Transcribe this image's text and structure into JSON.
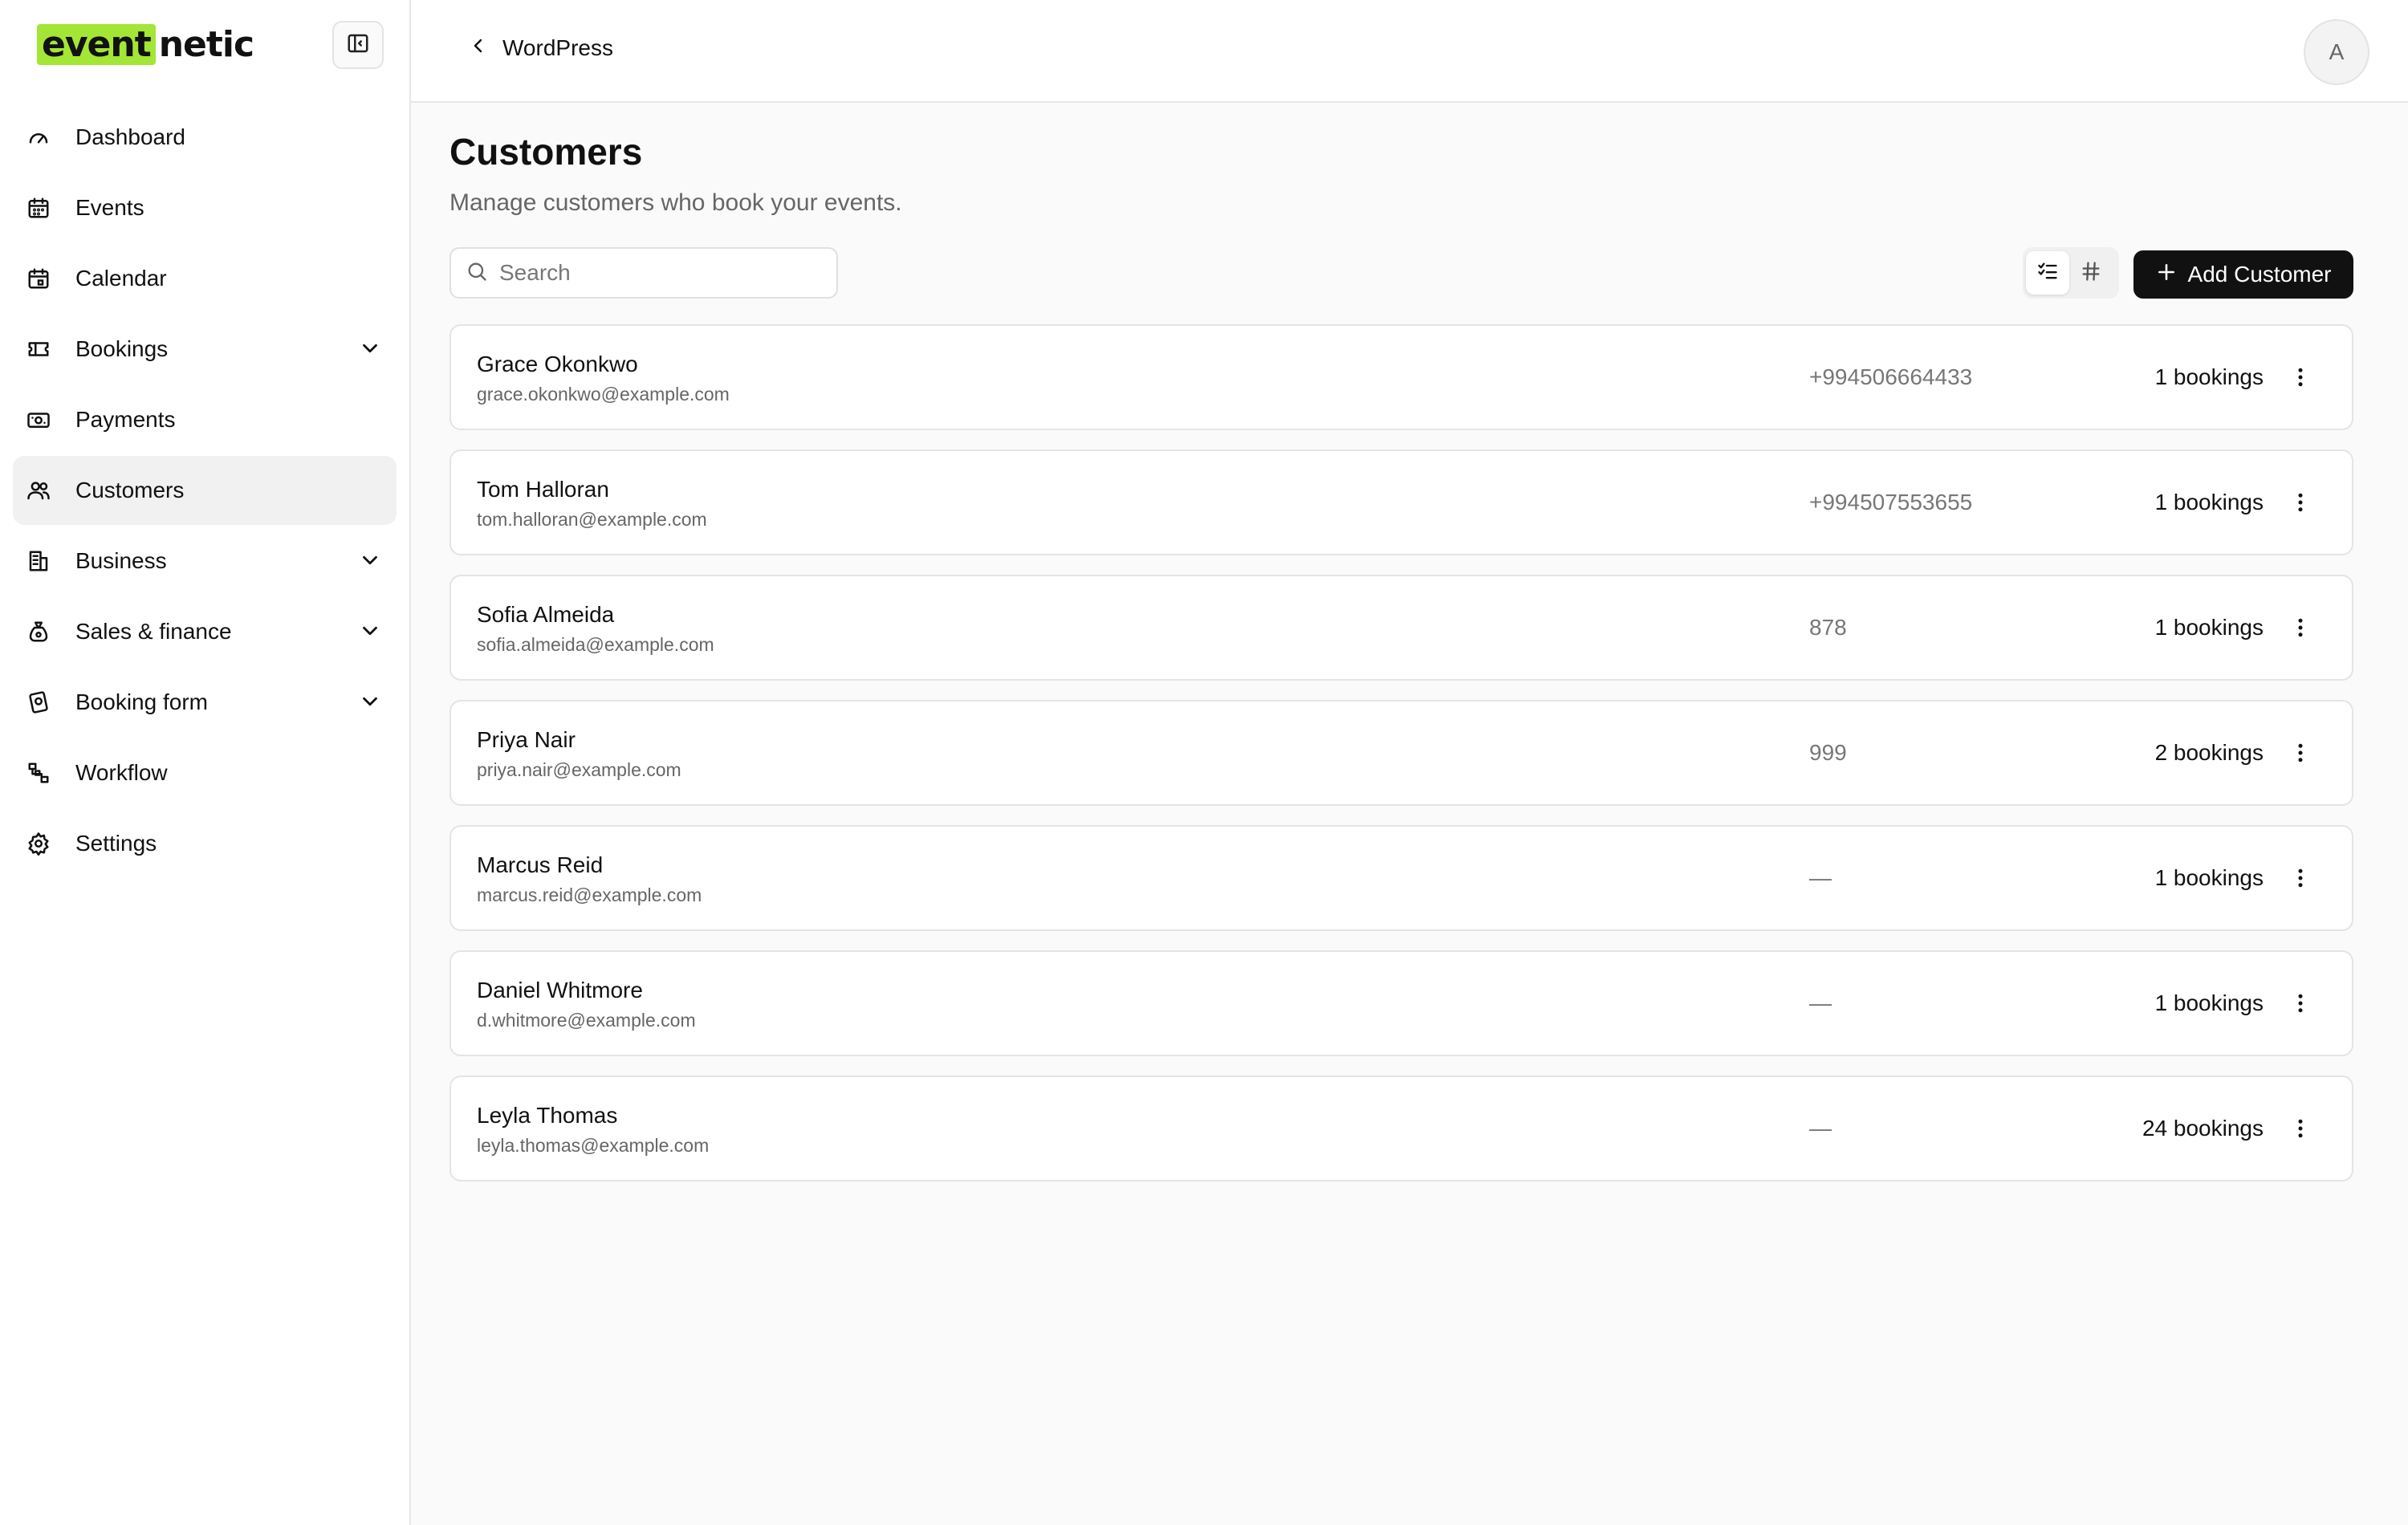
{
  "brand": {
    "highlight": "event",
    "rest": "netic",
    "accent": "#a3e635"
  },
  "sidebar": {
    "items": [
      {
        "label": "Dashboard",
        "icon": "gauge-icon",
        "expandable": false,
        "active": false
      },
      {
        "label": "Events",
        "icon": "calendar-days-icon",
        "expandable": false,
        "active": false
      },
      {
        "label": "Calendar",
        "icon": "calendar-icon",
        "expandable": false,
        "active": false
      },
      {
        "label": "Bookings",
        "icon": "ticket-icon",
        "expandable": true,
        "active": false
      },
      {
        "label": "Payments",
        "icon": "banknote-icon",
        "expandable": false,
        "active": false
      },
      {
        "label": "Customers",
        "icon": "users-icon",
        "expandable": false,
        "active": true
      },
      {
        "label": "Business",
        "icon": "building-icon",
        "expandable": true,
        "active": false
      },
      {
        "label": "Sales & finance",
        "icon": "money-bag-icon",
        "expandable": true,
        "active": false
      },
      {
        "label": "Booking form",
        "icon": "form-icon",
        "expandable": true,
        "active": false
      },
      {
        "label": "Workflow",
        "icon": "workflow-icon",
        "expandable": false,
        "active": false
      },
      {
        "label": "Settings",
        "icon": "gear-icon",
        "expandable": false,
        "active": false
      }
    ]
  },
  "header": {
    "back_label": "WordPress",
    "avatar_initial": "A"
  },
  "main": {
    "title": "Customers",
    "subtitle": "Manage customers who book your events.",
    "search_placeholder": "Search",
    "add_button_label": "Add Customer"
  },
  "customers": [
    {
      "name": "Grace Okonkwo",
      "email": "grace.okonkwo@example.com",
      "phone": "+994506664433",
      "bookings": "1 bookings"
    },
    {
      "name": "Tom Halloran",
      "email": "tom.halloran@example.com",
      "phone": "+994507553655",
      "bookings": "1 bookings"
    },
    {
      "name": "Sofia Almeida",
      "email": "sofia.almeida@example.com",
      "phone": "878",
      "bookings": "1 bookings"
    },
    {
      "name": "Priya Nair",
      "email": "priya.nair@example.com",
      "phone": "999",
      "bookings": "2 bookings"
    },
    {
      "name": "Marcus Reid",
      "email": "marcus.reid@example.com",
      "phone": "—",
      "bookings": "1 bookings"
    },
    {
      "name": "Daniel Whitmore",
      "email": "d.whitmore@example.com",
      "phone": "—",
      "bookings": "1 bookings"
    },
    {
      "name": "Leyla Thomas",
      "email": "leyla.thomas@example.com",
      "phone": "—",
      "bookings": "24 bookings"
    }
  ]
}
